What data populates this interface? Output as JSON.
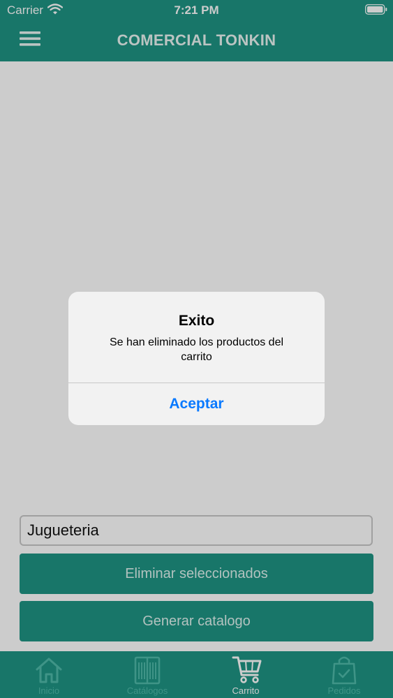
{
  "status_bar": {
    "carrier": "Carrier",
    "time": "7:21 PM"
  },
  "header": {
    "title": "COMERCIAL TONKIN",
    "menu_icon": "hamburger-menu-icon"
  },
  "form": {
    "catalog_name_value": "Jugueteria"
  },
  "actions": {
    "delete_selected_label": "Eliminar seleccionados",
    "generate_catalog_label": "Generar catalogo"
  },
  "tabs": [
    {
      "label": "Inicio",
      "icon": "home-icon",
      "active": false
    },
    {
      "label": "Catálogos",
      "icon": "catalog-book-icon",
      "active": false
    },
    {
      "label": "Carrito",
      "icon": "shopping-cart-icon",
      "active": true
    },
    {
      "label": "Pedidos",
      "icon": "shopping-bag-check-icon",
      "active": false
    }
  ],
  "alert": {
    "title": "Exito",
    "message": "Se han eliminado los productos del carrito",
    "button_label": "Aceptar"
  },
  "colors": {
    "primary": "#1e9484",
    "alert_button": "#0a7aff",
    "tab_inactive": "#4fbaa9",
    "tab_active": "#ffffff"
  }
}
